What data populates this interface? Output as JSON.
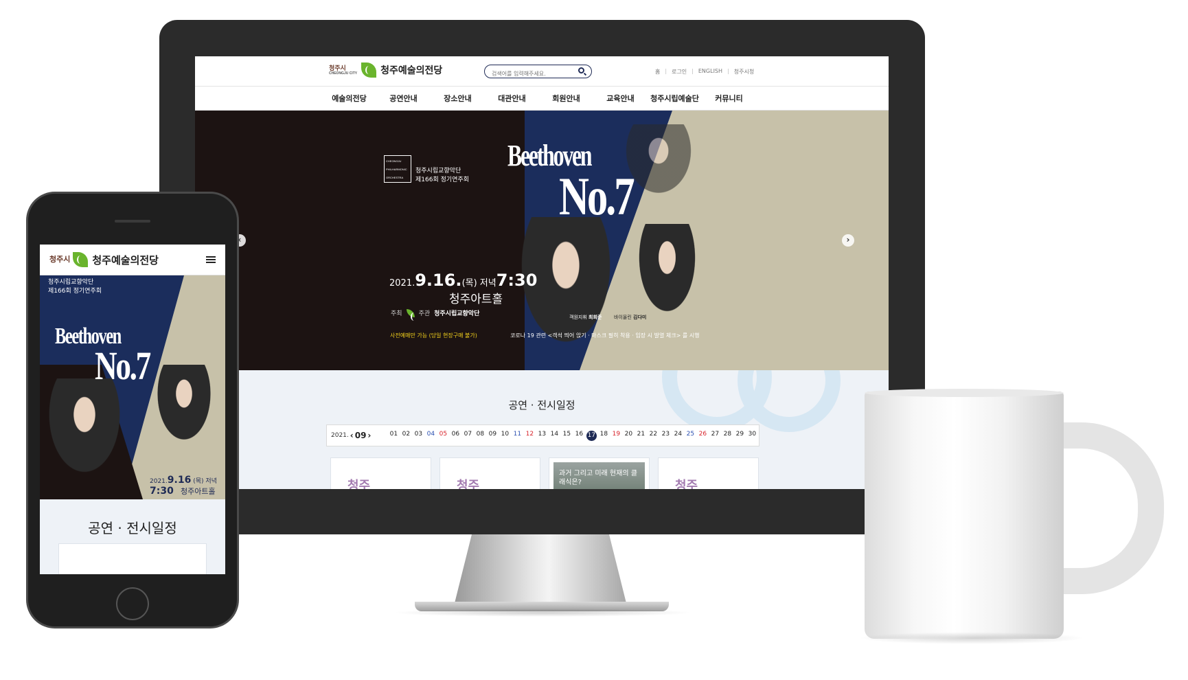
{
  "site": {
    "logo_city": "청주시",
    "logo_city_en": "CHEONGJU CITY",
    "logo_name": "청주예술의전당",
    "search_placeholder": "검색어를 입력해주세요.",
    "util_links": [
      "홈",
      "로그인",
      "ENGLISH",
      "청주시청"
    ],
    "gnb": [
      "예술의전당",
      "공연안내",
      "장소안내",
      "대관안내",
      "회원안내",
      "교육안내",
      "청주시립예술단",
      "커뮤니티"
    ]
  },
  "hero": {
    "orch_logo_lines": [
      "CHEONGJU",
      "PHILHARMONIC",
      "ORCHESTRA"
    ],
    "orch_name": "청주시립교향악단",
    "concert_number": "제166회 정기연주회",
    "title_top": "Beethoven",
    "title_main": "No.7",
    "date_prefix": "2021.",
    "date_main": "9.16.",
    "date_day": "(목) 저녁",
    "time": "7:30",
    "venue": "청주아트홀",
    "host_label": "주최",
    "organizer_label": "주관",
    "organizer": "청주시립교향악단",
    "presale_note": "사전예매만 가능 (당일 현장구매 불가)",
    "covid_note": "코로나 19 관련 <객석 띄어 앉기 · 마스크 필히 착용 · 입장 시 발열 체크> 를 시행",
    "conductor_label": "객원지휘",
    "conductor": "최희준",
    "violinist_label": "바이올린",
    "violinist": "김다미",
    "prev_arrow": "‹",
    "next_arrow": "›"
  },
  "schedule": {
    "title": "공연 · 전시일정",
    "year": "2021.",
    "month": "09",
    "prev_chevron": "‹",
    "next_chevron": "›",
    "days": [
      {
        "d": "01",
        "t": "wk"
      },
      {
        "d": "02",
        "t": "wk"
      },
      {
        "d": "03",
        "t": "wk"
      },
      {
        "d": "04",
        "t": "sat"
      },
      {
        "d": "05",
        "t": "sun"
      },
      {
        "d": "06",
        "t": "wk"
      },
      {
        "d": "07",
        "t": "wk"
      },
      {
        "d": "08",
        "t": "wk"
      },
      {
        "d": "09",
        "t": "wk"
      },
      {
        "d": "10",
        "t": "wk"
      },
      {
        "d": "11",
        "t": "sat"
      },
      {
        "d": "12",
        "t": "sun"
      },
      {
        "d": "13",
        "t": "wk"
      },
      {
        "d": "14",
        "t": "wk"
      },
      {
        "d": "15",
        "t": "wk"
      },
      {
        "d": "16",
        "t": "wk"
      },
      {
        "d": "17",
        "t": "active"
      },
      {
        "d": "18",
        "t": "wk"
      },
      {
        "d": "19",
        "t": "sun"
      },
      {
        "d": "20",
        "t": "wk"
      },
      {
        "d": "21",
        "t": "wk"
      },
      {
        "d": "22",
        "t": "wk"
      },
      {
        "d": "23",
        "t": "wk"
      },
      {
        "d": "24",
        "t": "wk"
      },
      {
        "d": "25",
        "t": "sat"
      },
      {
        "d": "26",
        "t": "sun"
      },
      {
        "d": "27",
        "t": "wk"
      },
      {
        "d": "28",
        "t": "wk"
      },
      {
        "d": "29",
        "t": "wk"
      },
      {
        "d": "30",
        "t": "wk"
      }
    ],
    "cards": [
      {
        "title": "청주",
        "kind": "text"
      },
      {
        "title": "청주",
        "kind": "text"
      },
      {
        "title": "과거 그리고 미래 현재의 클래식은?",
        "kind": "photo"
      },
      {
        "title": "청주",
        "kind": "text"
      }
    ]
  },
  "mobile": {
    "logo_city": "청주시",
    "logo_name": "청주예술의전당",
    "orch_name": "청주시립교향악단",
    "concert_number": "제166회 정기연주회",
    "title_top": "Beethoven",
    "title_main": "No.7",
    "date": "2021.",
    "date_main": "9.16",
    "date_day": "(목) 저녁",
    "time": "7:30",
    "venue": "청주아트홀",
    "schedule_title": "공연 · 전시일정"
  },
  "colors": {
    "navy": "#1e2a55",
    "brand_green": "#6ab42d",
    "hero_beige": "#c7c1a9",
    "presale_yellow": "#f3d21c",
    "saturday": "#2a4fb0",
    "sunday": "#d8222a"
  }
}
